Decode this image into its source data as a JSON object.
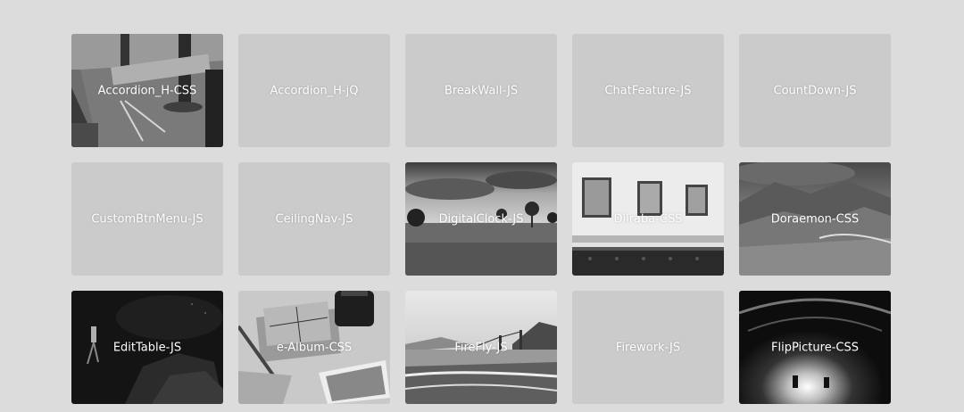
{
  "projects": [
    {
      "label": "Accordion_H-CSS",
      "thumbnail": "desk-compass-photo"
    },
    {
      "label": "Accordion_H-jQ",
      "thumbnail": ""
    },
    {
      "label": "BreakWall-JS",
      "thumbnail": ""
    },
    {
      "label": "ChatFeature-JS",
      "thumbnail": ""
    },
    {
      "label": "CountDown-JS",
      "thumbnail": ""
    },
    {
      "label": "CustomBtnMenu-JS",
      "thumbnail": ""
    },
    {
      "label": "CeilingNav-JS",
      "thumbnail": ""
    },
    {
      "label": "DigitalClock-JS",
      "thumbnail": "field-trees-photo"
    },
    {
      "label": "Dilraba-CSS",
      "thumbnail": "room-frames-sofa-photo"
    },
    {
      "label": "Doraemon-CSS",
      "thumbnail": "mountain-valley-photo"
    },
    {
      "label": "EditTable-JS",
      "thumbnail": "underwater-diver-photo"
    },
    {
      "label": "e-Album-CSS",
      "thumbnail": "letters-ink-photo"
    },
    {
      "label": "FireFly-JS",
      "thumbnail": "beach-bridge-photo"
    },
    {
      "label": "Firework-JS",
      "thumbnail": ""
    },
    {
      "label": "FlipPicture-CSS",
      "thumbnail": "tunnel-light-photo"
    }
  ]
}
